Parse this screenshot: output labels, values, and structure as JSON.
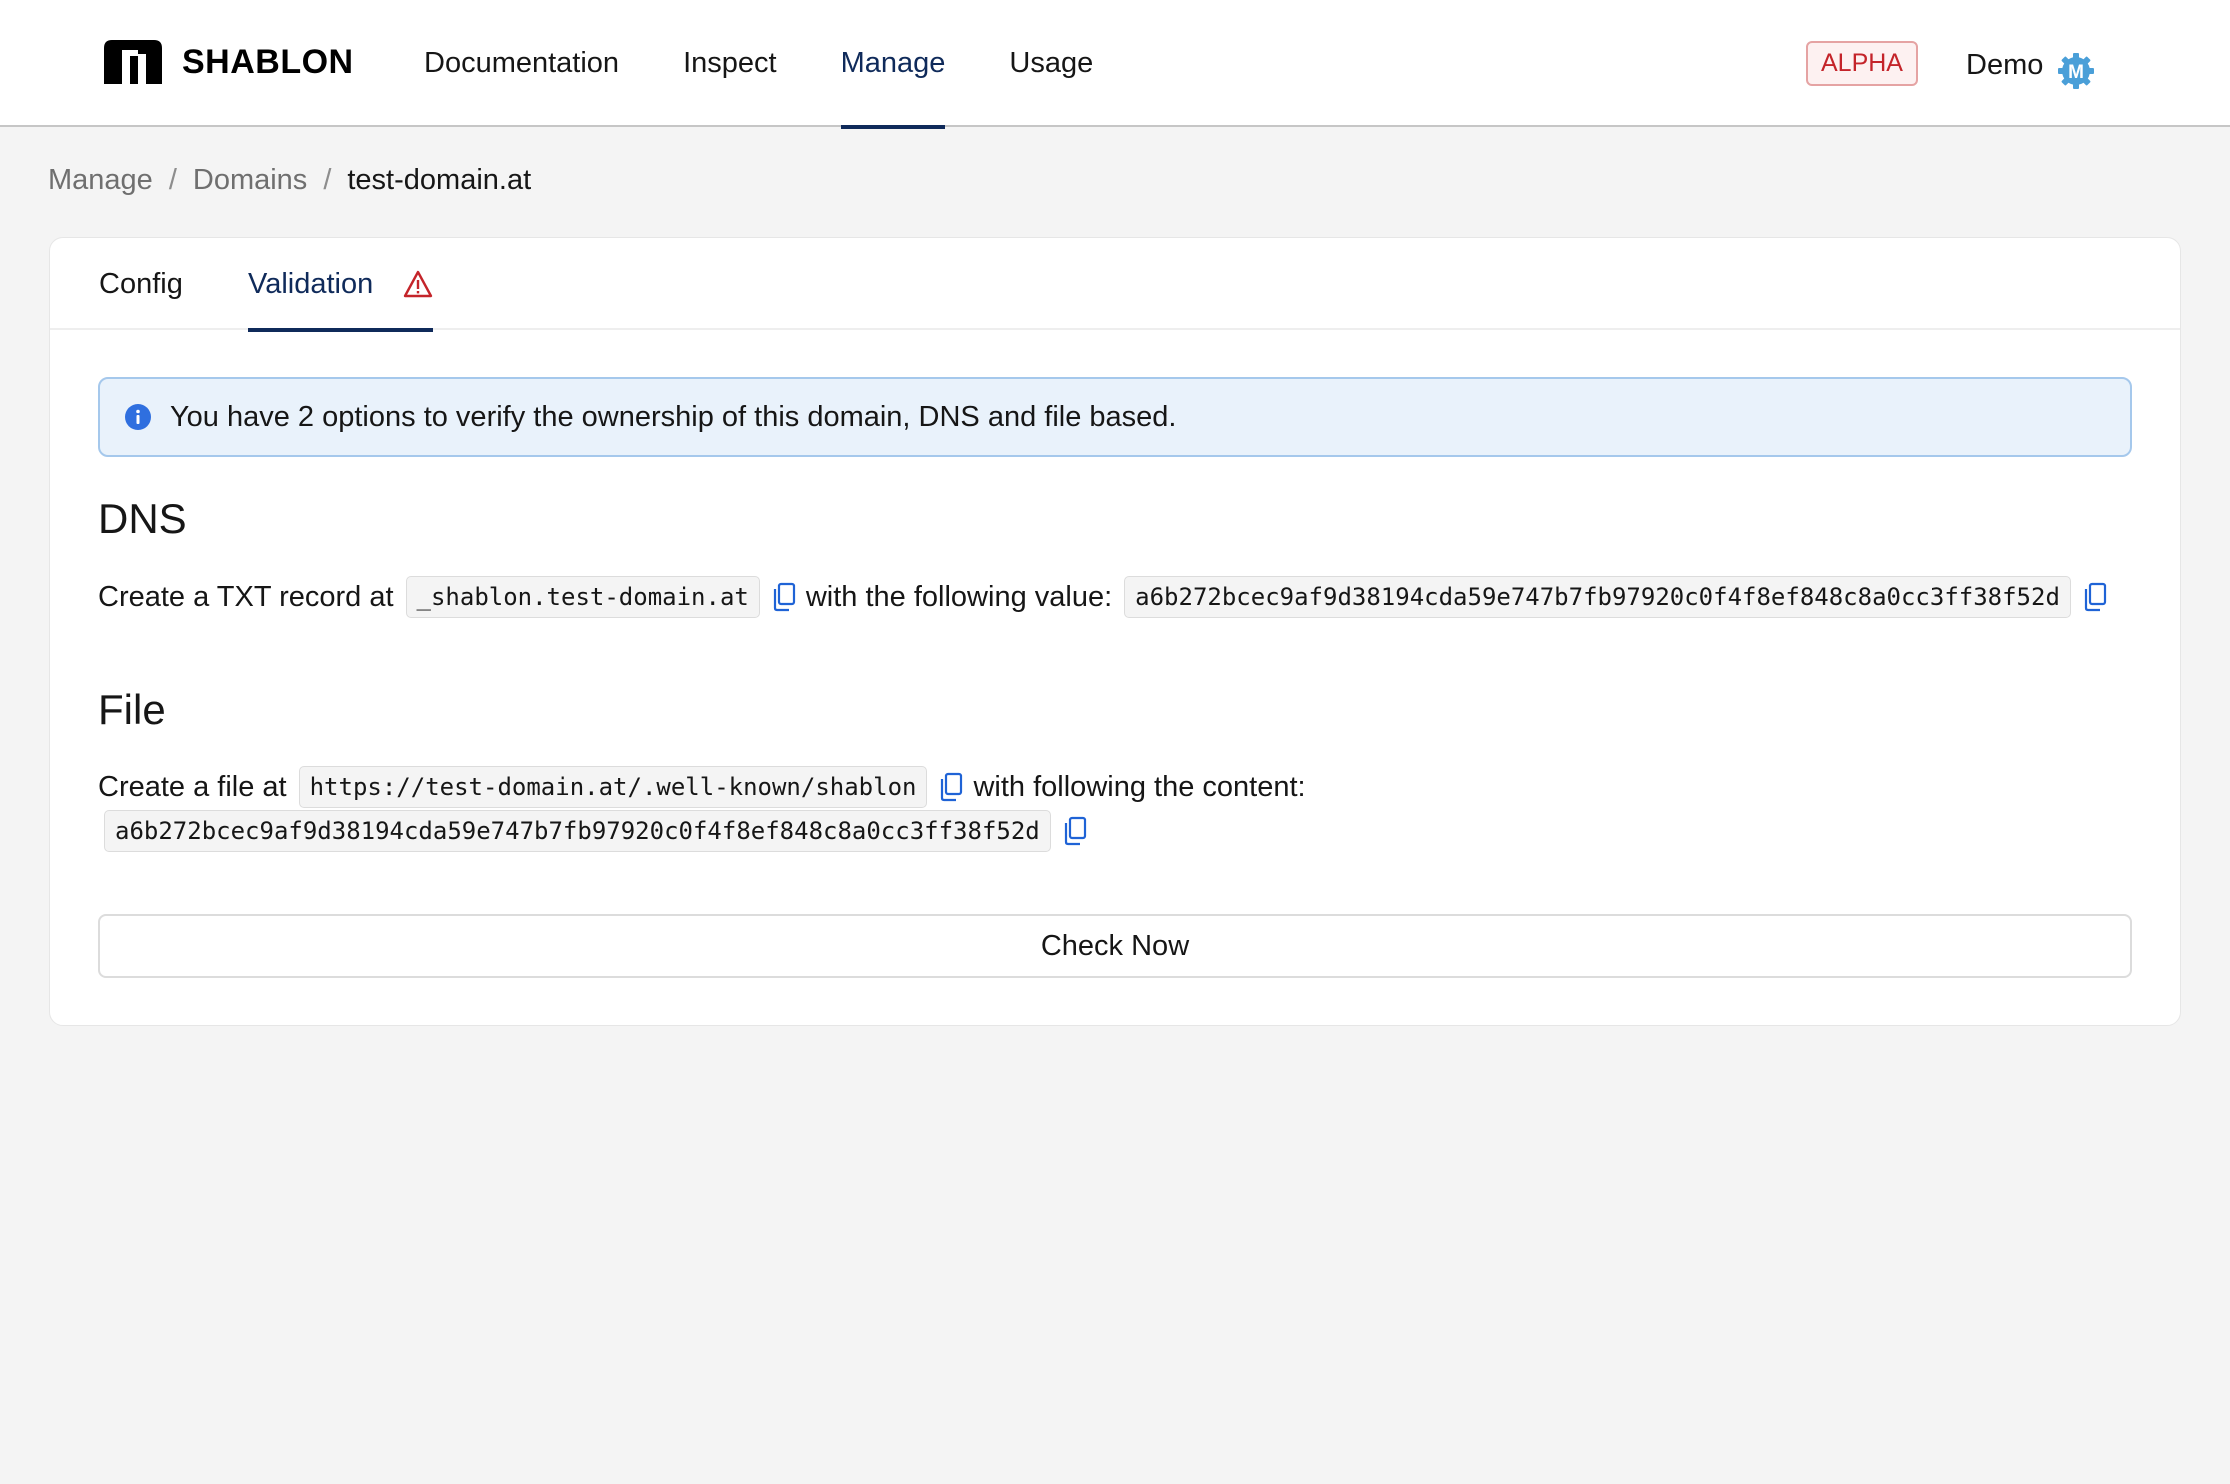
{
  "header": {
    "logo_text": "SHABLON",
    "nav": [
      {
        "label": "Documentation",
        "active": false
      },
      {
        "label": "Inspect",
        "active": false
      },
      {
        "label": "Manage",
        "active": true
      },
      {
        "label": "Usage",
        "active": false
      }
    ],
    "badge": "ALPHA",
    "user_name": "Demo",
    "avatar_letter": "M"
  },
  "breadcrumb": {
    "items": [
      "Manage",
      "Domains"
    ],
    "separator": "/",
    "current": "test-domain.at"
  },
  "tabs": {
    "config": "Config",
    "validation": "Validation",
    "active": "validation"
  },
  "info": {
    "text": "You have 2 options to verify the ownership of this domain, DNS and file based."
  },
  "dns": {
    "title": "DNS",
    "prefix": "Create a TXT record at",
    "record": "_shablon.test-domain.at",
    "middle": "with the following value:",
    "value": "a6b272bcec9af9d38194cda59e747b7fb97920c0f4f8ef848c8a0cc3ff38f52d"
  },
  "file": {
    "title": "File",
    "prefix": "Create a file at",
    "url": "https://test-domain.at/.well-known/shablon",
    "middle": "with following the content:",
    "content": "a6b272bcec9af9d38194cda59e747b7fb97920c0f4f8ef848c8a0cc3ff38f52d"
  },
  "actions": {
    "check_now": "Check Now"
  },
  "colors": {
    "accent": "#0f2a5a",
    "alpha_red": "#c4242a",
    "info_blue": "#2f6fdf",
    "copy_blue": "#1f63d6",
    "avatar_blue": "#4a9fd8"
  },
  "icons": {
    "logo": "shablon-logo-icon",
    "avatar": "gear-avatar-icon",
    "warning": "warning-triangle-icon",
    "info": "info-icon",
    "copy": "copy-icon"
  }
}
